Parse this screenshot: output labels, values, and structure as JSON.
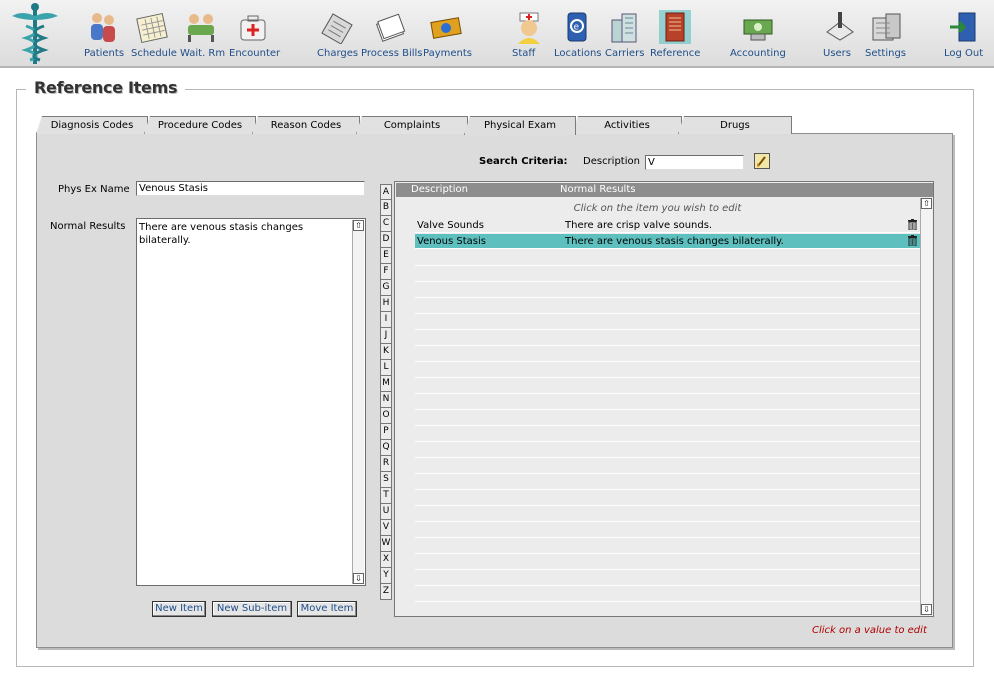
{
  "toolbar": {
    "items": [
      {
        "label": "Patients",
        "icon": "patients-icon"
      },
      {
        "label": "Schedule",
        "icon": "schedule-icon"
      },
      {
        "label": "Wait. Rm",
        "icon": "waiting-room-icon"
      },
      {
        "label": "Encounter",
        "icon": "encounter-icon"
      },
      {
        "label": "Charges",
        "icon": "charges-icon"
      },
      {
        "label": "Process Bills",
        "icon": "process-bills-icon"
      },
      {
        "label": "Payments",
        "icon": "payments-icon"
      },
      {
        "label": "Staff",
        "icon": "staff-icon"
      },
      {
        "label": "Locations",
        "icon": "locations-icon"
      },
      {
        "label": "Carriers",
        "icon": "carriers-icon"
      },
      {
        "label": "Reference",
        "icon": "reference-icon"
      },
      {
        "label": "Accounting",
        "icon": "accounting-icon"
      },
      {
        "label": "Users",
        "icon": "users-icon"
      },
      {
        "label": "Settings",
        "icon": "settings-icon"
      },
      {
        "label": "Log Out",
        "icon": "logout-icon"
      }
    ]
  },
  "page": {
    "title": "Reference Items"
  },
  "tabs": [
    {
      "label": "Diagnosis Codes",
      "active": false
    },
    {
      "label": "Procedure Codes",
      "active": false
    },
    {
      "label": "Reason Codes",
      "active": false
    },
    {
      "label": "Complaints",
      "active": false
    },
    {
      "label": "Physical Exam",
      "active": true
    },
    {
      "label": "Activities",
      "active": false
    },
    {
      "label": "Drugs",
      "active": false
    }
  ],
  "search": {
    "label": "Search Criteria:",
    "field_label": "Description",
    "value": "V"
  },
  "form": {
    "name_label": "Phys Ex Name",
    "name_value": "Venous Stasis",
    "results_label": "Normal Results",
    "results_value": "There are venous stasis changes bilaterally."
  },
  "buttons": {
    "new_item": "New Item",
    "new_sub_item": "New Sub-item",
    "move_item": "Move Item"
  },
  "alphabet": [
    "A",
    "B",
    "C",
    "D",
    "E",
    "F",
    "G",
    "H",
    "I",
    "J",
    "K",
    "L",
    "M",
    "N",
    "O",
    "P",
    "Q",
    "R",
    "S",
    "T",
    "U",
    "V",
    "W",
    "X",
    "Y",
    "Z"
  ],
  "list": {
    "columns": [
      "Description",
      "Normal Results"
    ],
    "hint": "Click on the item you wish to edit",
    "rows": [
      {
        "description": "Valve Sounds",
        "normal_results": "There are crisp valve sounds.",
        "selected": false
      },
      {
        "description": "Venous Stasis",
        "normal_results": "There are venous stasis changes bilaterally.",
        "selected": true
      }
    ]
  },
  "edit_hint": "Click on a value to edit",
  "colors": {
    "selection": "#5ebfbf",
    "toolbar_label": "#1f4e8a",
    "hint_red": "#b00000"
  }
}
